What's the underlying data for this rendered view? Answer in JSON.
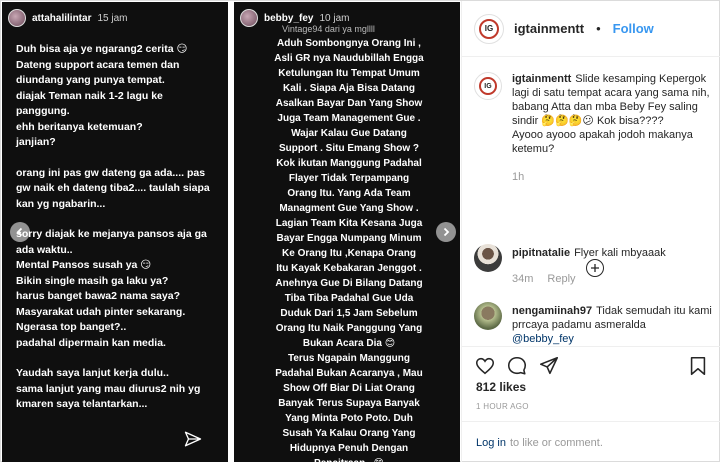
{
  "story1": {
    "username": "attahalilintar",
    "time": "15 jam",
    "lines": [
      "Duh bisa aja ye ngarang2 cerita 😏",
      "Dateng support acara temen dan",
      "diundang yang punya tempat.",
      "diajak Teman naik 1-2 lagu ke",
      "panggung.",
      "ehh beritanya ketemuan?",
      "janjian?",
      "",
      "orang ini pas gw dateng ga ada.... pas",
      "gw naik eh dateng tiba2.... taulah siapa",
      "kan yg ngabarin...",
      "",
      "sorry diajak ke mejanya pansos aja ga",
      "ada waktu..",
      "Mental Pansos susah ya 😏",
      "Bikin single masih ga laku ya?",
      "harus banget bawa2 nama saya?",
      "Masyarakat udah pinter sekarang.",
      "Ngerasa top banget?..",
      "padahal dipermain kan media.",
      "",
      "Yaudah saya lanjut kerja dulu..",
      "sama lanjut yang mau diurus2 nih yg",
      "kmaren saya telantarkan..."
    ]
  },
  "story2": {
    "username": "bebby_fey",
    "time": "10 jam",
    "subtitle": "Vintage94 dari ya mgllll",
    "lines": [
      "Aduh Sombongnya Orang Ini ,",
      "Asli GR nya Naudubillah Engga",
      "Ketulungan Itu Tempat Umum",
      "Kali . Siapa Aja Bisa Datang",
      "Asalkan Bayar Dan Yang Show",
      "Juga Team Management Gue .",
      "Wajar Kalau Gue Datang",
      "Support . Situ Emang Show ?",
      "Kok ikutan Manggung Padahal",
      "Flayer Tidak Terpampang",
      "Orang Itu. Yang Ada Team",
      "Managment Gue Yang Show .",
      "Lagian Team Kita Kesana Juga",
      "Bayar Engga Numpang  Minum",
      "Ke  Orang Itu ,Kenapa Orang",
      "Itu Kayak Kebakaran Jenggot .",
      "Anehnya Gue Di Bilang Datang",
      "Tiba Tiba Padahal Gue Uda",
      "Duduk Dari 1,5 Jam Sebelum",
      "Orang Itu Naik Panggung Yang",
      "Bukan Acara Dia 😊",
      "Terus Ngapain Manggung",
      "Padahal Bukan Acaranya , Mau",
      "Show Off Biar Di Liat Orang",
      "Banyak Terus Supaya Banyak",
      "Yang Minta Poto Poto. Duh",
      "Susah Ya Kalau Orang Yang",
      "Hidupnya Penuh Dengan",
      "Pencitraan . 😊"
    ]
  },
  "header": {
    "username": "igtainmentt",
    "separator": "•",
    "follow_label": "Follow"
  },
  "caption": {
    "username": "igtainmentt",
    "text": "Slide kesamping Kepergok lagi di satu tempat acara yang sama nih, babang Atta dan mba Beby Fey saling sindir 🤔🤔🤔😕 Kok bisa????",
    "text2": "Ayooo ayooo apakah jodoh makanya ketemu?",
    "time": "1h"
  },
  "comments": [
    {
      "username": "pipitnatalie",
      "text": "Flyer kali mbyaaak",
      "time": "34m",
      "reply_label": "Reply"
    },
    {
      "username": "nengamiinah97",
      "text": "Tidak semudah itu kami prrcaya padamu asmeralda",
      "mention": "@bebby_fey"
    }
  ],
  "likes": "812 likes",
  "post_time": "1 HOUR AGO",
  "login": {
    "link": "Log in",
    "rest": "to like or comment."
  }
}
